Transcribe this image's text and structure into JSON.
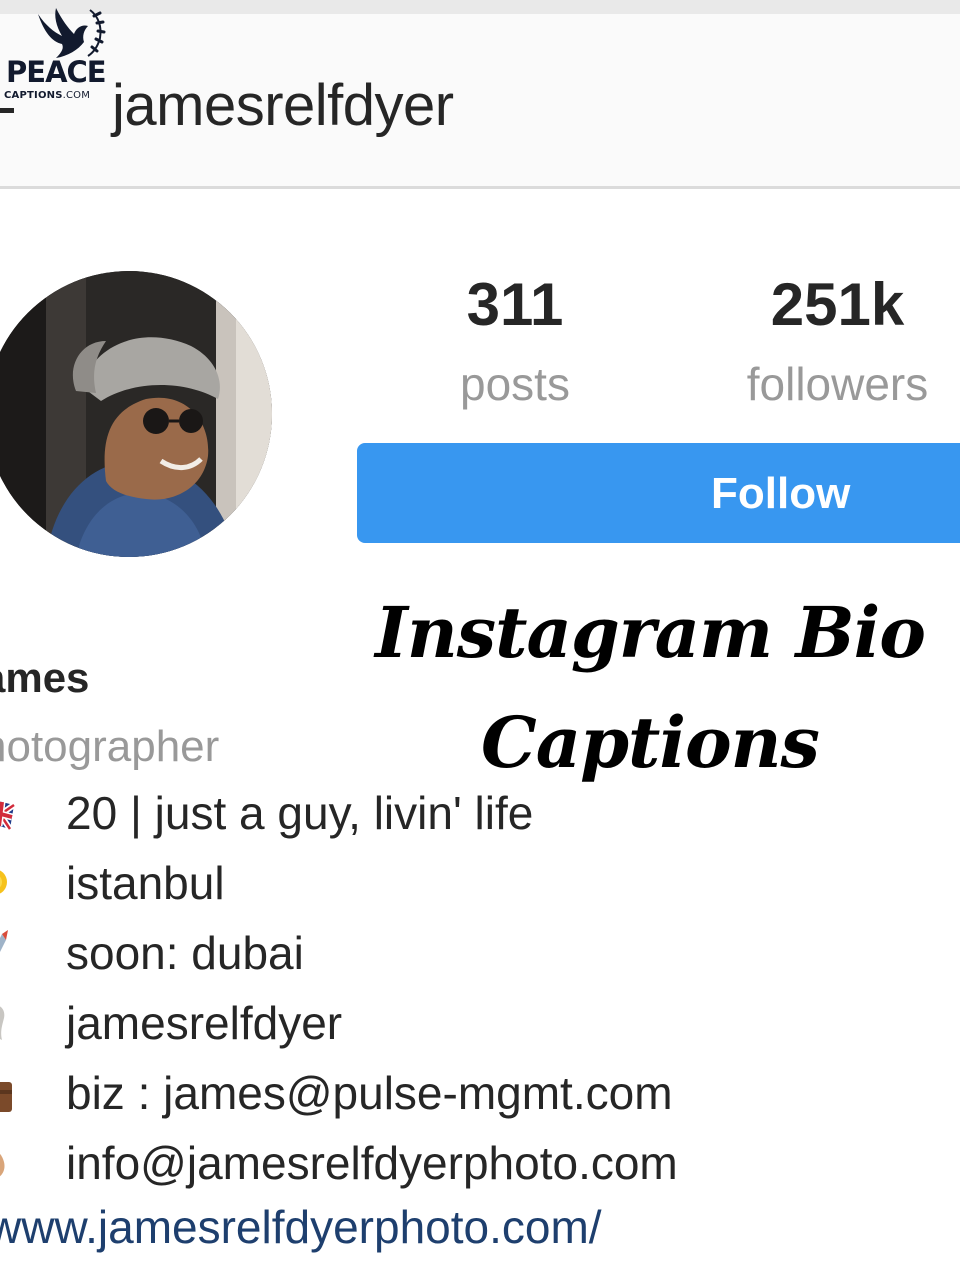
{
  "logo": {
    "line1": "PEACE",
    "line2": "CAPTIONS",
    "line2_suffix": ".COM"
  },
  "header": {
    "username": "jamesrelfdyer"
  },
  "stats": {
    "posts": {
      "value": "311",
      "label": "posts"
    },
    "followers": {
      "value": "251k",
      "label": "followers"
    }
  },
  "actions": {
    "follow_label": "Follow"
  },
  "overlay": {
    "line1": "Instagram Bio",
    "line2": "Captions"
  },
  "bio": {
    "name": "ames",
    "role": "hotographer",
    "lines": [
      {
        "icon": "uk-flag-icon",
        "text": "20 | just a guy, livin' life"
      },
      {
        "icon": "sun-icon",
        "text": "istanbul"
      },
      {
        "icon": "rocket-icon",
        "text": "soon: dubai"
      },
      {
        "icon": "ghost-icon",
        "text": "jamesrelfdyer"
      },
      {
        "icon": "briefcase-icon",
        "text": "biz : james@pulse-mgmt.com"
      },
      {
        "icon": "hand-icon",
        "text": "info@jamesrelfdyerphoto.com"
      }
    ],
    "website": "www.jamesrelfdyerphoto.com/"
  },
  "colors": {
    "follow_blue": "#3897f0",
    "link_blue": "#1e3f6e",
    "muted_text": "#999999"
  }
}
